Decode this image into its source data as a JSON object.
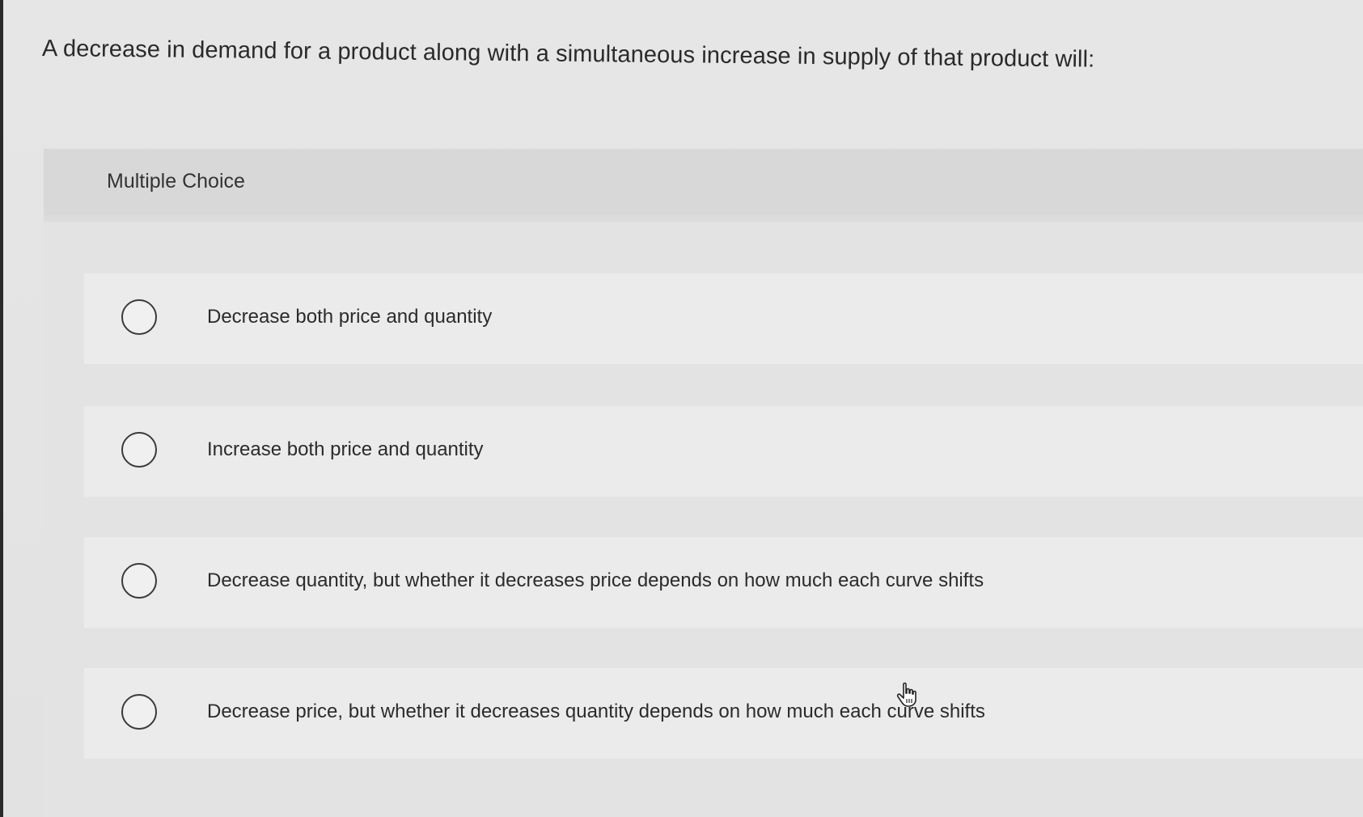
{
  "question": {
    "text": "A decrease in demand for a product along with a simultaneous increase in supply of that product will:"
  },
  "multiple_choice": {
    "label": "Multiple Choice",
    "options": [
      {
        "label": "Decrease both price and quantity",
        "selected": false
      },
      {
        "label": "Increase both price and quantity",
        "selected": false
      },
      {
        "label": "Decrease quantity, but whether it decreases price depends on how much each curve shifts",
        "selected": false
      },
      {
        "label": "Decrease price, but whether it decreases quantity depends on how much each curve shifts",
        "selected": false
      }
    ]
  },
  "colors": {
    "background": "#e6e6e6",
    "panel": "#dcdcdc",
    "choice_row": "#ebebeb",
    "text": "#2b2b2b"
  },
  "icons": {
    "cursor": "hand-pointer-icon",
    "radio": "radio-circle-icon"
  }
}
